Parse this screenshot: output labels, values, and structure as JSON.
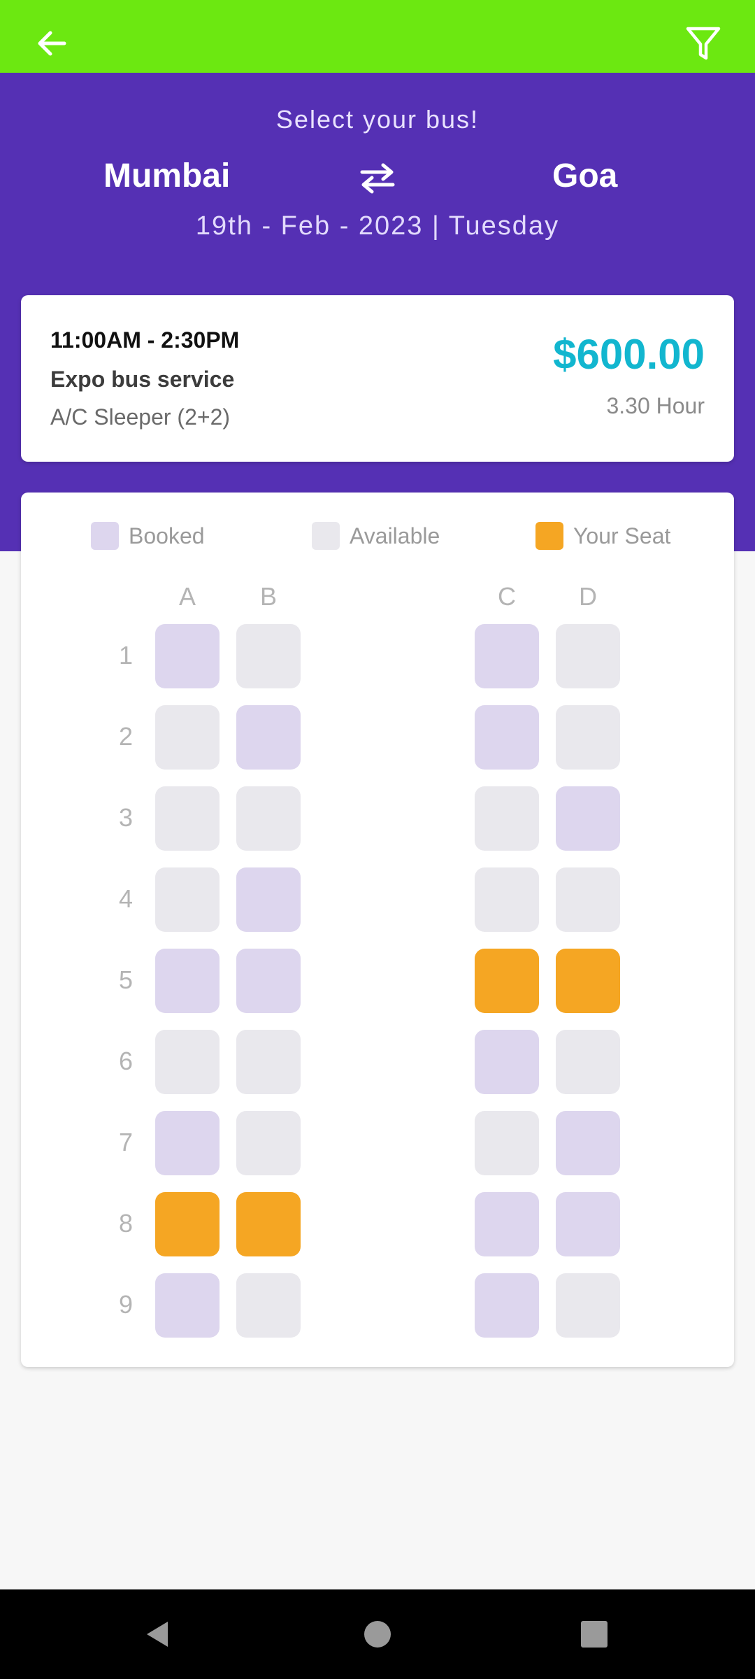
{
  "colors": {
    "topbar": "#6ce811",
    "hero": "#5530b4",
    "booked": "#ddd6ee",
    "available": "#e9e8ed",
    "your_seat": "#f5a623",
    "price": "#12b6cf"
  },
  "header": {
    "back_icon": "arrow-left-icon",
    "filter_icon": "filter-icon"
  },
  "route": {
    "subtitle": "Select your bus!",
    "from": "Mumbai",
    "to": "Goa",
    "swap_icon": "swap-arrows-icon",
    "date": "19th - Feb - 2023 | Tuesday"
  },
  "trip": {
    "time": "11:00AM - 2:30PM",
    "bus_name": "Expo bus service",
    "bus_type": "A/C Sleeper (2+2)",
    "price": "$600.00",
    "duration": "3.30 Hour"
  },
  "legend": [
    {
      "label": "Booked",
      "status": "booked"
    },
    {
      "label": "Available",
      "status": "available"
    },
    {
      "label": "Your Seat",
      "status": "your_seat"
    }
  ],
  "seats": {
    "columns": [
      "A",
      "B",
      "C",
      "D"
    ],
    "rows": [
      {
        "num": "1",
        "status": [
          "booked",
          "available",
          "booked",
          "available"
        ]
      },
      {
        "num": "2",
        "status": [
          "available",
          "booked",
          "booked",
          "available"
        ]
      },
      {
        "num": "3",
        "status": [
          "available",
          "available",
          "available",
          "booked"
        ]
      },
      {
        "num": "4",
        "status": [
          "available",
          "booked",
          "available",
          "available"
        ]
      },
      {
        "num": "5",
        "status": [
          "booked",
          "booked",
          "your_seat",
          "your_seat"
        ]
      },
      {
        "num": "6",
        "status": [
          "available",
          "available",
          "booked",
          "available"
        ]
      },
      {
        "num": "7",
        "status": [
          "booked",
          "available",
          "available",
          "booked"
        ]
      },
      {
        "num": "8",
        "status": [
          "your_seat",
          "your_seat",
          "booked",
          "booked"
        ]
      },
      {
        "num": "9",
        "status": [
          "booked",
          "available",
          "booked",
          "available"
        ]
      }
    ]
  },
  "system_nav": {
    "back_icon": "nav-back-icon",
    "home_icon": "nav-home-icon",
    "recents_icon": "nav-recents-icon"
  }
}
